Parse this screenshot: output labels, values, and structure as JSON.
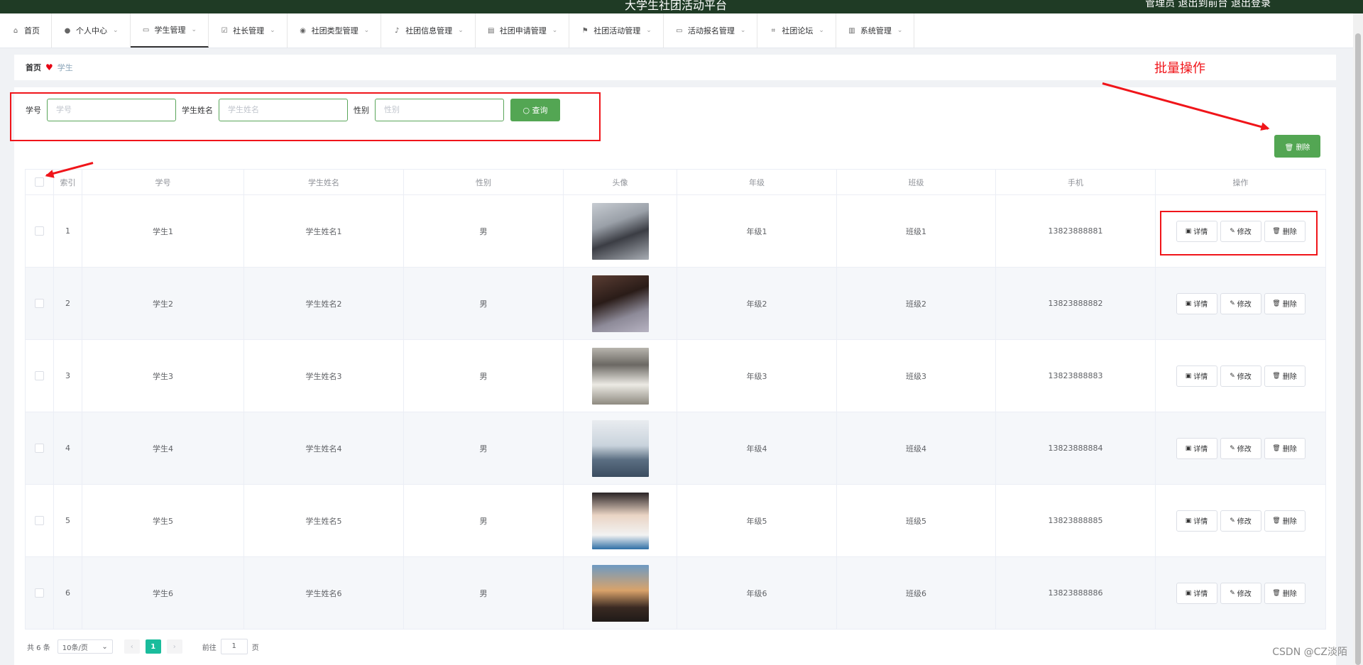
{
  "app": {
    "title": "大学生社团活动平台",
    "header_right": "管理员  退出到前台  退出登录"
  },
  "nav": [
    {
      "label": "首页",
      "icon": "home-icon",
      "glyph": "⌂",
      "chevron": false
    },
    {
      "label": "个人中心",
      "icon": "user-icon",
      "glyph": "●",
      "chevron": true
    },
    {
      "label": "学生管理",
      "icon": "student-icon",
      "glyph": "▭",
      "chevron": true,
      "active": true
    },
    {
      "label": "社长管理",
      "icon": "checkbox-icon",
      "glyph": "☑",
      "chevron": true
    },
    {
      "label": "社团类型管理",
      "icon": "location-icon",
      "glyph": "◉",
      "chevron": true
    },
    {
      "label": "社团信息管理",
      "icon": "bell-icon",
      "glyph": "♪",
      "chevron": true
    },
    {
      "label": "社团申请管理",
      "icon": "document-icon",
      "glyph": "▤",
      "chevron": true
    },
    {
      "label": "社团活动管理",
      "icon": "flag-icon",
      "glyph": "⚑",
      "chevron": true
    },
    {
      "label": "活动报名管理",
      "icon": "card-icon",
      "glyph": "▭",
      "chevron": true
    },
    {
      "label": "社团论坛",
      "icon": "crop-icon",
      "glyph": "⌗",
      "chevron": true
    },
    {
      "label": "系统管理",
      "icon": "server-icon",
      "glyph": "▥",
      "chevron": true
    }
  ],
  "breadcrumb": {
    "home": "首页",
    "current": "学生"
  },
  "search": {
    "fields": [
      {
        "label": "学号",
        "placeholder": "学号"
      },
      {
        "label": "学生姓名",
        "placeholder": "学生姓名"
      },
      {
        "label": "性别",
        "placeholder": "性别"
      }
    ],
    "button": "查询"
  },
  "annotation": {
    "batch_label": "批量操作"
  },
  "batch_delete": "删除",
  "table": {
    "headers": [
      "索引",
      "学号",
      "学生姓名",
      "性别",
      "头像",
      "年级",
      "班级",
      "手机",
      "操作"
    ],
    "rows": [
      {
        "index": "1",
        "id": "学生1",
        "name": "学生姓名1",
        "gender": "男",
        "grade": "年级1",
        "class": "班级1",
        "phone": "13823888881"
      },
      {
        "index": "2",
        "id": "学生2",
        "name": "学生姓名2",
        "gender": "男",
        "grade": "年级2",
        "class": "班级2",
        "phone": "13823888882"
      },
      {
        "index": "3",
        "id": "学生3",
        "name": "学生姓名3",
        "gender": "男",
        "grade": "年级3",
        "class": "班级3",
        "phone": "13823888883"
      },
      {
        "index": "4",
        "id": "学生4",
        "name": "学生姓名4",
        "gender": "男",
        "grade": "年级4",
        "class": "班级4",
        "phone": "13823888884"
      },
      {
        "index": "5",
        "id": "学生5",
        "name": "学生姓名5",
        "gender": "男",
        "grade": "年级5",
        "class": "班级5",
        "phone": "13823888885"
      },
      {
        "index": "6",
        "id": "学生6",
        "name": "学生姓名6",
        "gender": "男",
        "grade": "年级6",
        "class": "班级6",
        "phone": "13823888886"
      }
    ],
    "actions": {
      "detail": "详情",
      "edit": "修改",
      "delete": "删除"
    }
  },
  "pagination": {
    "total": "共 6 条",
    "page_size": "10条/页",
    "current_page": "1",
    "goto_prefix": "前往",
    "goto_value": "1",
    "goto_suffix": "页"
  },
  "watermark": "CSDN @CZ淡陌",
  "colors": {
    "header": "#1f3b25",
    "primary": "#53a653",
    "annotation": "#f0151a",
    "page_active": "#1abc9c"
  }
}
